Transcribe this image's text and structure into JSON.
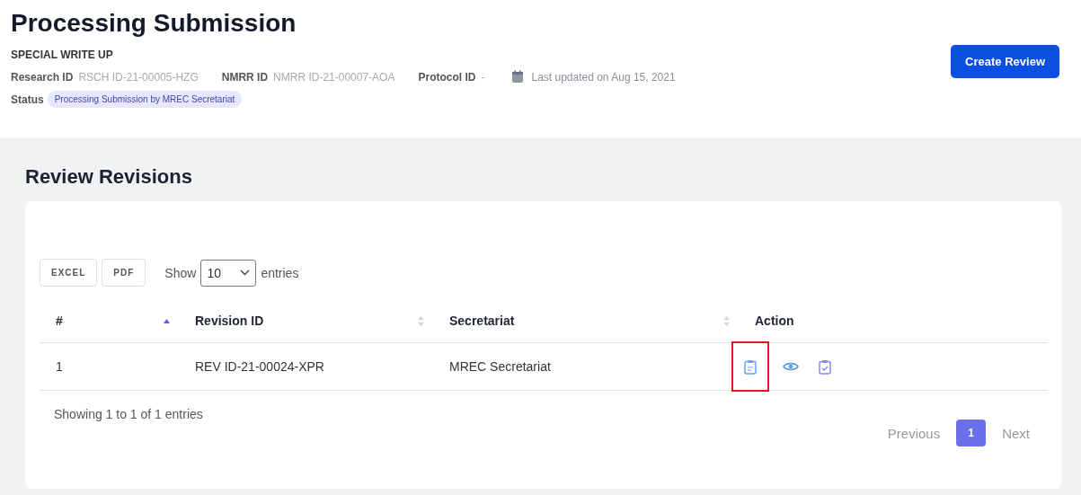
{
  "header": {
    "title": "Processing Submission",
    "subtitle": "SPECIAL WRITE UP",
    "meta": [
      {
        "label": "Research ID",
        "value": "RSCH ID-21-00005-HZG"
      },
      {
        "label": "NMRR ID",
        "value": "NMRR ID-21-00007-AOA"
      },
      {
        "label": "Protocol ID",
        "value": "-"
      }
    ],
    "last_updated": "Last updated on Aug 15, 2021",
    "status_label": "Status",
    "status": "Processing Submission by MREC Secretariat",
    "button": "Create Review"
  },
  "section": {
    "title": "Review Revisions",
    "export_buttons": [
      "EXCEL",
      "PDF"
    ],
    "show_label": "Show",
    "page_size": "10",
    "entries_label": "entries",
    "table": {
      "columns": [
        {
          "label": "#",
          "sortable": true,
          "sorted_ascending": true
        },
        {
          "label": "Revision ID",
          "sortable": true,
          "sorted_ascending": false
        },
        {
          "label": "Secretariat",
          "sortable": true,
          "sorted_ascending": false
        },
        {
          "label": "Action",
          "sortable": false,
          "sorted_ascending": false
        }
      ],
      "rows": [
        {
          "cells": [
            "1",
            "REV ID-21-00024-XPR",
            "MREC Secretariat"
          ],
          "actions": [
            {
              "kind": "clipboard",
              "highlighted": true
            },
            {
              "kind": "view",
              "highlighted": false
            },
            {
              "kind": "approve",
              "highlighted": false
            }
          ]
        }
      ]
    },
    "info": "Showing 1 to 1 of 1 entries",
    "pagination": {
      "previous": "Previous",
      "pages": [
        {
          "label": "1",
          "selected": true
        }
      ],
      "next": "Next"
    }
  }
}
